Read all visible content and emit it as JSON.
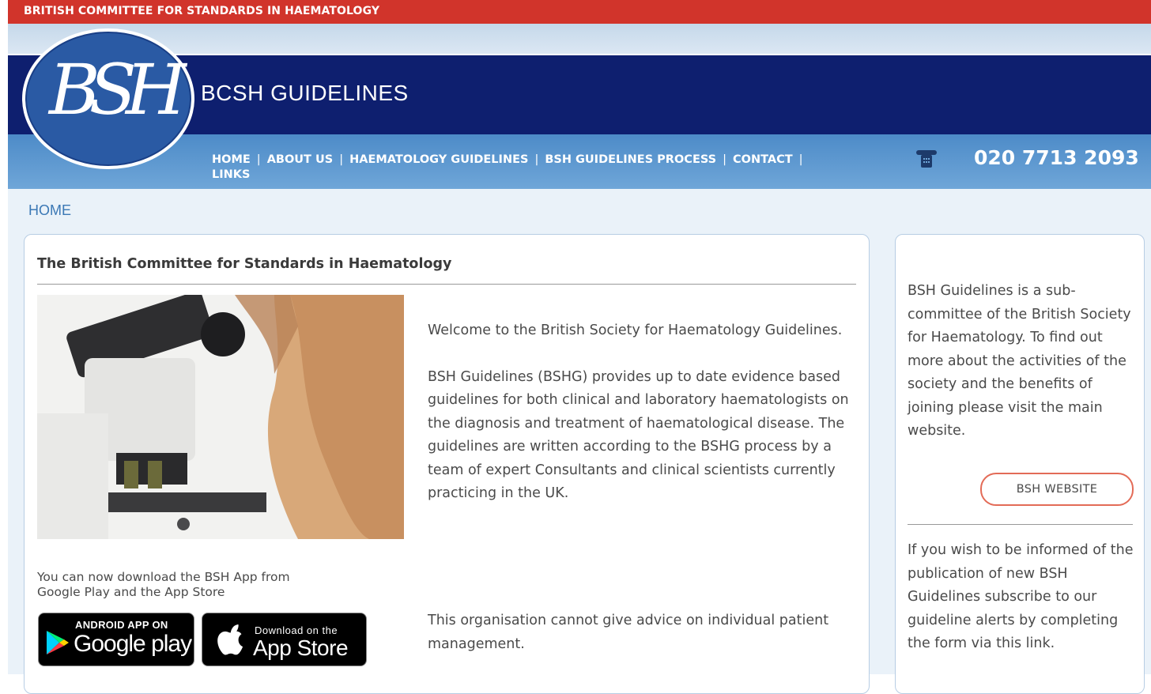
{
  "top_banner": "BRITISH COMMITTEE FOR STANDARDS IN HAEMATOLOGY",
  "logo_text": "BSH",
  "site_title": "BCSH GUIDELINES",
  "nav": {
    "items": [
      "HOME",
      "ABOUT US",
      "HAEMATOLOGY GUIDELINES",
      "BSH GUIDELINES PROCESS",
      "CONTACT",
      "LINKS"
    ],
    "separator": "|"
  },
  "phone": "020 7713 2093",
  "breadcrumb": "HOME",
  "main": {
    "title": "The British Committee for Standards in Haematology",
    "paragraphs": [
      "Welcome to the British Society for Haematology Guidelines.",
      "BSH Guidelines (BSHG) provides up to date evidence based guidelines for both clinical and laboratory haematologists on the diagnosis and treatment of haematological disease. The guidelines are written according to the BSHG process by a team of expert Consultants and clinical scientists currently practicing in the UK."
    ],
    "advice": "This organisation cannot give advice on individual patient management.",
    "app_note": "You can now download the BSH App from Google Play and the App Store"
  },
  "badges": {
    "google_small": "ANDROID APP ON",
    "google_big": "Google play",
    "apple_small": "Download on the",
    "apple_big": "App Store"
  },
  "sidebar": {
    "text1": "BSH Guidelines is a sub-committee of the British Society for Haematology. To find out more about the activities of the society and the benefits of joining please visit the main website.",
    "button": "BSH WEBSITE",
    "text2": "If you wish to be informed of the publication of new BSH Guidelines subscribe to our guideline alerts by completing the form via this link."
  },
  "colors": {
    "top_red": "#d1342b",
    "navy": "#0e1f6f",
    "nav_blue": "#5a96d0",
    "link_blue": "#3b78b5",
    "button_border": "#e36b57"
  }
}
